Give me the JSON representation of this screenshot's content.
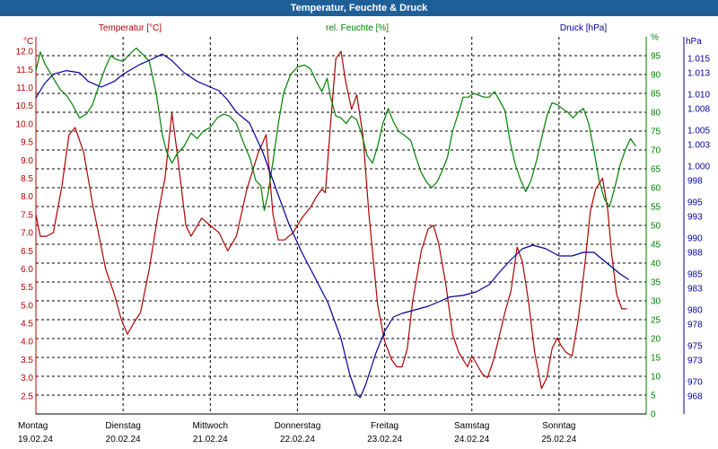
{
  "title": "Temperatur, Feuchte & Druck",
  "colors": {
    "temperature": "#b00000",
    "humidity": "#008000",
    "pressure": "#00009a",
    "titlebar": "#1f5f98"
  },
  "chart_data": {
    "type": "line",
    "grid": true,
    "x_categories": [
      {
        "day": "Montag",
        "date": "19.02.24"
      },
      {
        "day": "Dienstag",
        "date": "20.02.24"
      },
      {
        "day": "Mittwoch",
        "date": "21.02.24"
      },
      {
        "day": "Donnerstag",
        "date": "22.02.24"
      },
      {
        "day": "Freitag",
        "date": "23.02.24"
      },
      {
        "day": "Samstag",
        "date": "24.02.24"
      },
      {
        "day": "Sonntag",
        "date": "25.02.24"
      }
    ],
    "x_range_days": [
      0,
      7
    ],
    "axes": {
      "temperature": {
        "label": "Temperatur [°C]",
        "unit": "°C",
        "range": [
          2,
          12.4
        ],
        "ticks": [
          "3.0",
          "2.5",
          "3.5",
          "4.0",
          "4.5",
          "5.0",
          "5.5",
          "6.0",
          "6.5",
          "7.0",
          "7.5",
          "8.0",
          "8.5",
          "9.0",
          "9.5",
          "10.0",
          "10.5",
          "11.0",
          "11.5",
          "12.0"
        ],
        "tick_values": [
          3.0,
          2.5,
          3.5,
          4.0,
          4.5,
          5.0,
          5.5,
          6.0,
          6.5,
          7.0,
          7.5,
          8.0,
          8.5,
          9.0,
          9.5,
          10.0,
          10.5,
          11.0,
          11.5,
          12.0
        ]
      },
      "humidity": {
        "label": "rel. Feuchte [%]",
        "unit": "%",
        "range": [
          0,
          100
        ],
        "ticks": [
          "0",
          "5",
          "10",
          "15",
          "20",
          "25",
          "30",
          "35",
          "40",
          "45",
          "50",
          "55",
          "60",
          "65",
          "70",
          "75",
          "80",
          "85",
          "90",
          "95",
          "%"
        ],
        "tick_values": [
          0,
          5,
          10,
          15,
          20,
          25,
          30,
          35,
          40,
          45,
          50,
          55,
          60,
          65,
          70,
          75,
          80,
          85,
          90,
          95,
          100
        ]
      },
      "pressure": {
        "label": "Druck [hPa]",
        "unit": "hPa",
        "range": [
          965.5,
          1018.0
        ],
        "ticks": [
          "968",
          "970",
          "973",
          "975",
          "978",
          "980",
          "983",
          "985",
          "988",
          "990",
          "993",
          "995",
          "998",
          "1.000",
          "1.003",
          "1.005",
          "1.008",
          "1.010",
          "1.013",
          "1.015"
        ],
        "tick_values": [
          968,
          970,
          973,
          975,
          978,
          980,
          983,
          985,
          988,
          990,
          993,
          995,
          998,
          1000,
          1003,
          1005,
          1008,
          1010,
          1013,
          1015
        ]
      }
    },
    "series": [
      {
        "name": "Temperatur [°C]",
        "axis": "temperature",
        "color": "#b00000",
        "points": [
          [
            0,
            7.5
          ],
          [
            0.05,
            6.9
          ],
          [
            0.12,
            6.9
          ],
          [
            0.2,
            7.0
          ],
          [
            0.3,
            8.3
          ],
          [
            0.38,
            9.7
          ],
          [
            0.45,
            9.9
          ],
          [
            0.55,
            9.2
          ],
          [
            0.65,
            7.8
          ],
          [
            0.8,
            6.0
          ],
          [
            0.9,
            5.3
          ],
          [
            0.98,
            4.6
          ],
          [
            1.05,
            4.2
          ],
          [
            1.12,
            4.5
          ],
          [
            1.2,
            4.8
          ],
          [
            1.3,
            6.0
          ],
          [
            1.4,
            7.5
          ],
          [
            1.48,
            8.5
          ],
          [
            1.56,
            10.3
          ],
          [
            1.62,
            9.2
          ],
          [
            1.72,
            7.2
          ],
          [
            1.78,
            6.9
          ],
          [
            1.9,
            7.4
          ],
          [
            2.0,
            7.2
          ],
          [
            2.1,
            7.0
          ],
          [
            2.2,
            6.5
          ],
          [
            2.3,
            6.9
          ],
          [
            2.42,
            8.2
          ],
          [
            2.55,
            9.2
          ],
          [
            2.64,
            9.7
          ],
          [
            2.72,
            7.5
          ],
          [
            2.78,
            6.8
          ],
          [
            2.85,
            6.8
          ],
          [
            2.95,
            7.0
          ],
          [
            3.05,
            7.4
          ],
          [
            3.15,
            7.7
          ],
          [
            3.22,
            8.0
          ],
          [
            3.28,
            8.2
          ],
          [
            3.32,
            8.1
          ],
          [
            3.38,
            10.0
          ],
          [
            3.44,
            11.8
          ],
          [
            3.5,
            12.0
          ],
          [
            3.55,
            11.2
          ],
          [
            3.62,
            10.4
          ],
          [
            3.68,
            10.8
          ],
          [
            3.75,
            9.7
          ],
          [
            3.82,
            7.5
          ],
          [
            3.92,
            5.0
          ],
          [
            4.0,
            4.0
          ],
          [
            4.08,
            3.5
          ],
          [
            4.14,
            3.3
          ],
          [
            4.2,
            3.3
          ],
          [
            4.26,
            3.8
          ],
          [
            4.32,
            5.1
          ],
          [
            4.42,
            6.5
          ],
          [
            4.5,
            7.1
          ],
          [
            4.56,
            7.2
          ],
          [
            4.62,
            6.7
          ],
          [
            4.7,
            5.6
          ],
          [
            4.78,
            4.2
          ],
          [
            4.85,
            3.7
          ],
          [
            4.9,
            3.5
          ],
          [
            4.95,
            3.3
          ],
          [
            5.0,
            3.6
          ],
          [
            5.05,
            3.4
          ],
          [
            5.12,
            3.1
          ],
          [
            5.18,
            3.0
          ],
          [
            5.25,
            3.5
          ],
          [
            5.32,
            4.2
          ],
          [
            5.38,
            4.8
          ],
          [
            5.45,
            5.4
          ],
          [
            5.52,
            6.6
          ],
          [
            5.58,
            6.2
          ],
          [
            5.65,
            5.1
          ],
          [
            5.72,
            3.7
          ],
          [
            5.8,
            2.7
          ],
          [
            5.86,
            3.0
          ],
          [
            5.92,
            3.8
          ],
          [
            5.98,
            4.1
          ],
          [
            6.02,
            3.9
          ],
          [
            6.08,
            3.7
          ],
          [
            6.15,
            3.6
          ],
          [
            6.22,
            4.6
          ],
          [
            6.3,
            6.2
          ],
          [
            6.36,
            7.6
          ],
          [
            6.42,
            8.2
          ],
          [
            6.5,
            8.5
          ],
          [
            6.56,
            7.6
          ],
          [
            6.6,
            6.5
          ],
          [
            6.66,
            5.3
          ],
          [
            6.72,
            4.9
          ],
          [
            6.78,
            4.9
          ]
        ]
      },
      {
        "name": "rel. Feuchte [%]",
        "axis": "humidity",
        "color": "#008000",
        "points": [
          [
            0,
            91.0
          ],
          [
            0.05,
            96.0
          ],
          [
            0.1,
            93.0
          ],
          [
            0.2,
            89.0
          ],
          [
            0.28,
            86.0
          ],
          [
            0.35,
            84.5
          ],
          [
            0.42,
            82.0
          ],
          [
            0.5,
            78.5
          ],
          [
            0.58,
            79.5
          ],
          [
            0.65,
            82.0
          ],
          [
            0.73,
            87.5
          ],
          [
            0.8,
            92.0
          ],
          [
            0.86,
            95.0
          ],
          [
            0.92,
            94.0
          ],
          [
            1.0,
            93.5
          ],
          [
            1.08,
            95.5
          ],
          [
            1.15,
            97.0
          ],
          [
            1.22,
            95.5
          ],
          [
            1.3,
            93.5
          ],
          [
            1.38,
            85.0
          ],
          [
            1.45,
            74.0
          ],
          [
            1.5,
            69.5
          ],
          [
            1.56,
            66.5
          ],
          [
            1.62,
            69.0
          ],
          [
            1.7,
            71.0
          ],
          [
            1.78,
            74.5
          ],
          [
            1.85,
            73.0
          ],
          [
            1.92,
            75.0
          ],
          [
            2.0,
            76.0
          ],
          [
            2.08,
            78.5
          ],
          [
            2.15,
            79.5
          ],
          [
            2.22,
            79.0
          ],
          [
            2.3,
            77.0
          ],
          [
            2.38,
            72.0
          ],
          [
            2.46,
            67.5
          ],
          [
            2.52,
            62.0
          ],
          [
            2.58,
            60.5
          ],
          [
            2.62,
            54.0
          ],
          [
            2.66,
            58.0
          ],
          [
            2.72,
            67.0
          ],
          [
            2.78,
            77.0
          ],
          [
            2.84,
            85.0
          ],
          [
            2.92,
            90.0
          ],
          [
            3.0,
            92.0
          ],
          [
            3.08,
            92.5
          ],
          [
            3.15,
            91.5
          ],
          [
            3.22,
            88.0
          ],
          [
            3.28,
            85.5
          ],
          [
            3.34,
            89.0
          ],
          [
            3.38,
            84.0
          ],
          [
            3.44,
            79.0
          ],
          [
            3.5,
            78.5
          ],
          [
            3.56,
            77.0
          ],
          [
            3.62,
            79.0
          ],
          [
            3.68,
            78.0
          ],
          [
            3.74,
            74.0
          ],
          [
            3.8,
            68.5
          ],
          [
            3.86,
            66.5
          ],
          [
            3.92,
            71.0
          ],
          [
            3.98,
            77.0
          ],
          [
            4.04,
            81.0
          ],
          [
            4.1,
            77.5
          ],
          [
            4.16,
            75.0
          ],
          [
            4.22,
            74.0
          ],
          [
            4.3,
            72.5
          ],
          [
            4.36,
            68.0
          ],
          [
            4.42,
            64.0
          ],
          [
            4.48,
            61.5
          ],
          [
            4.54,
            60.0
          ],
          [
            4.6,
            61.5
          ],
          [
            4.66,
            64.5
          ],
          [
            4.72,
            68.0
          ],
          [
            4.78,
            75.0
          ],
          [
            4.85,
            80.0
          ],
          [
            4.9,
            84.0
          ],
          [
            4.96,
            84.0
          ],
          [
            5.02,
            85.0
          ],
          [
            5.08,
            84.5
          ],
          [
            5.14,
            84.0
          ],
          [
            5.2,
            84.0
          ],
          [
            5.26,
            85.5
          ],
          [
            5.32,
            83.0
          ],
          [
            5.38,
            80.5
          ],
          [
            5.44,
            72.0
          ],
          [
            5.5,
            66.0
          ],
          [
            5.56,
            62.0
          ],
          [
            5.62,
            59.0
          ],
          [
            5.68,
            62.0
          ],
          [
            5.74,
            67.0
          ],
          [
            5.8,
            73.0
          ],
          [
            5.86,
            79.0
          ],
          [
            5.92,
            82.5
          ],
          [
            5.98,
            82.0
          ],
          [
            6.04,
            81.0
          ],
          [
            6.1,
            80.0
          ],
          [
            6.16,
            78.5
          ],
          [
            6.22,
            80.0
          ],
          [
            6.28,
            81.0
          ],
          [
            6.34,
            77.0
          ],
          [
            6.4,
            70.0
          ],
          [
            6.46,
            62.0
          ],
          [
            6.52,
            57.0
          ],
          [
            6.58,
            55.0
          ],
          [
            6.64,
            60.0
          ],
          [
            6.7,
            66.0
          ],
          [
            6.76,
            70.0
          ],
          [
            6.82,
            73.0
          ],
          [
            6.88,
            71.0
          ]
        ]
      },
      {
        "name": "Druck [hPa]",
        "axis": "pressure",
        "color": "#00009a",
        "points": [
          [
            0,
            1009.5
          ],
          [
            0.1,
            1011.5
          ],
          [
            0.2,
            1012.8
          ],
          [
            0.35,
            1013.3
          ],
          [
            0.5,
            1013.0
          ],
          [
            0.6,
            1011.8
          ],
          [
            0.75,
            1011.0
          ],
          [
            0.9,
            1011.8
          ],
          [
            1.0,
            1012.8
          ],
          [
            1.2,
            1014.2
          ],
          [
            1.35,
            1015.0
          ],
          [
            1.45,
            1015.6
          ],
          [
            1.55,
            1014.8
          ],
          [
            1.7,
            1013.0
          ],
          [
            1.85,
            1011.8
          ],
          [
            2.0,
            1011.0
          ],
          [
            2.1,
            1010.5
          ],
          [
            2.2,
            1009.2
          ],
          [
            2.3,
            1007.5
          ],
          [
            2.45,
            1006.0
          ],
          [
            2.6,
            1002.0
          ],
          [
            2.75,
            997.0
          ],
          [
            2.9,
            992.0
          ],
          [
            3.05,
            988.0
          ],
          [
            3.2,
            984.5
          ],
          [
            3.35,
            981.0
          ],
          [
            3.5,
            976.0
          ],
          [
            3.6,
            971.0
          ],
          [
            3.68,
            968.2
          ],
          [
            3.72,
            967.8
          ],
          [
            3.78,
            969.5
          ],
          [
            3.9,
            974.0
          ],
          [
            4.0,
            977.0
          ],
          [
            4.1,
            979.0
          ],
          [
            4.2,
            979.5
          ],
          [
            4.35,
            980.0
          ],
          [
            4.5,
            980.5
          ],
          [
            4.6,
            981.0
          ],
          [
            4.75,
            981.8
          ],
          [
            4.9,
            982.0
          ],
          [
            5.05,
            982.5
          ],
          [
            5.2,
            983.5
          ],
          [
            5.3,
            985.0
          ],
          [
            5.45,
            987.0
          ],
          [
            5.58,
            988.5
          ],
          [
            5.7,
            989.0
          ],
          [
            5.85,
            988.5
          ],
          [
            6.0,
            987.5
          ],
          [
            6.15,
            987.5
          ],
          [
            6.28,
            988.0
          ],
          [
            6.4,
            988.0
          ],
          [
            6.5,
            987.0
          ],
          [
            6.6,
            986.0
          ],
          [
            6.7,
            985.0
          ],
          [
            6.8,
            984.2
          ]
        ]
      }
    ]
  }
}
